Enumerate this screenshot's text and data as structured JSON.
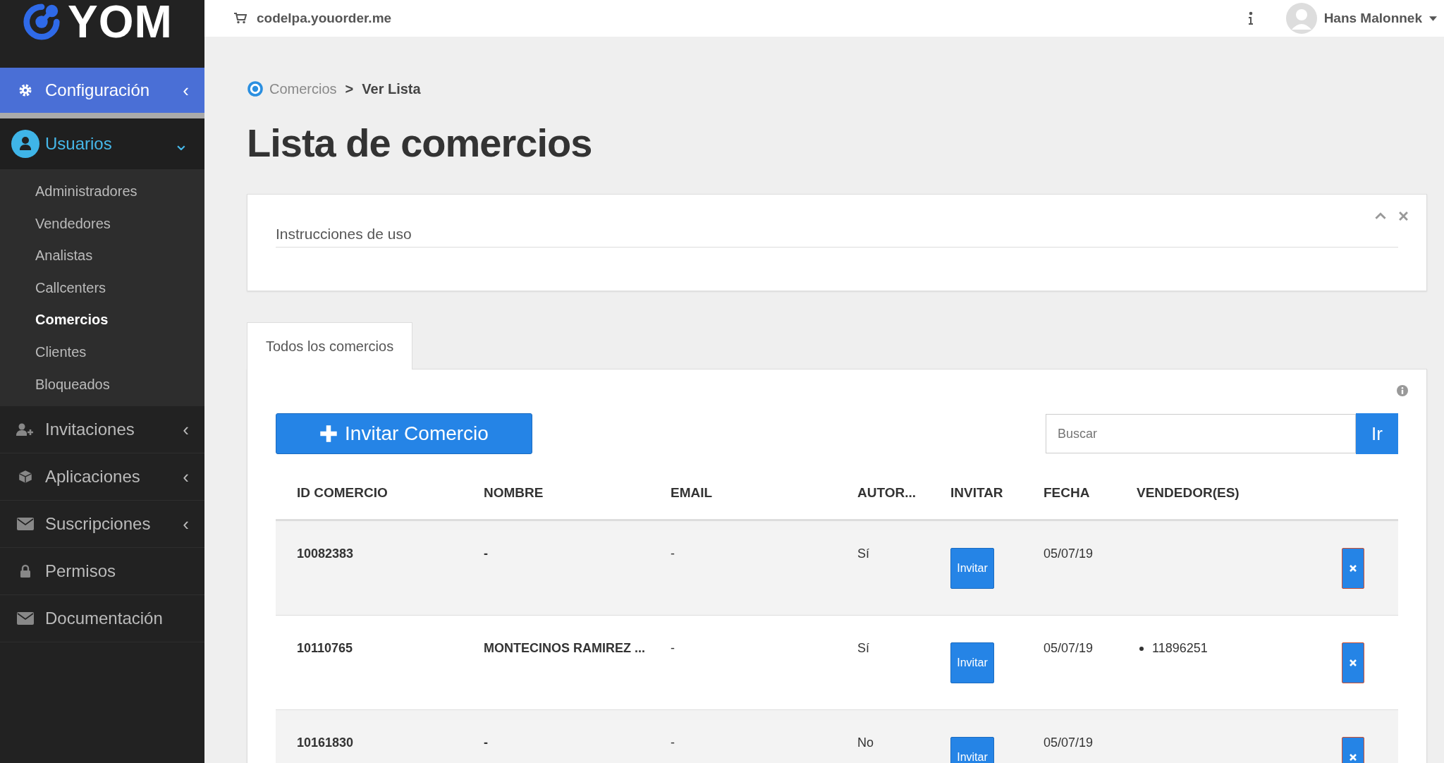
{
  "sidebar": {
    "logo": "YOM",
    "items": [
      {
        "label": "Configuración",
        "kind": "gear",
        "selected": true,
        "arrow": "‹",
        "expanded": false
      },
      {
        "label": "Usuarios",
        "kind": "user",
        "selected": false,
        "arrow": "⌄",
        "expanded": true,
        "children": [
          {
            "label": "Administradores",
            "selected": false
          },
          {
            "label": "Vendedores",
            "selected": false
          },
          {
            "label": "Analistas",
            "selected": false
          },
          {
            "label": "Callcenters",
            "selected": false
          },
          {
            "label": "Comercios",
            "selected": true
          },
          {
            "label": "Clientes",
            "selected": false
          },
          {
            "label": "Bloqueados",
            "selected": false
          }
        ]
      },
      {
        "label": "Invitaciones",
        "kind": "user-plus",
        "selected": false,
        "arrow": "‹",
        "expanded": false
      },
      {
        "label": "Aplicaciones",
        "kind": "cube",
        "selected": false,
        "arrow": "‹",
        "expanded": false
      },
      {
        "label": "Suscripciones",
        "kind": "envelope",
        "selected": false,
        "arrow": "‹",
        "expanded": false
      },
      {
        "label": "Permisos",
        "kind": "lock",
        "selected": false,
        "expanded": false
      },
      {
        "label": "Documentación",
        "kind": "envelope",
        "selected": false,
        "expanded": false
      }
    ]
  },
  "topbar": {
    "site": "codelpa.youorder.me",
    "user": "Hans Malonnek"
  },
  "breadcrumb": {
    "parent": "Comercios",
    "separator": ">",
    "current": "Ver Lista"
  },
  "title": "Lista de comercios",
  "instructions": {
    "title": "Instrucciones de uso"
  },
  "tabs": [
    {
      "label": "Todos los comercios",
      "selected": true
    }
  ],
  "invite_button": "Invitar Comercio",
  "search": {
    "placeholder": "Buscar",
    "button": "Ir"
  },
  "table": {
    "columns": [
      "ID COMERCIO",
      "NOMBRE",
      "EMAIL",
      "AUTOR...",
      "INVITAR",
      "FECHA",
      "VENDEDOR(ES)"
    ],
    "rows": [
      {
        "id": "10082383",
        "name": "-",
        "email": "-",
        "auth": "Sí",
        "invite": "Invitar",
        "date": "05/07/19",
        "sellers": []
      },
      {
        "id": "10110765",
        "name": "MONTECINOS RAMIREZ ...",
        "email": "-",
        "auth": "Sí",
        "invite": "Invitar",
        "date": "05/07/19",
        "sellers": [
          "11896251"
        ]
      },
      {
        "id": "10161830",
        "name": "-",
        "email": "-",
        "auth": "No",
        "invite": "Invitar",
        "date": "05/07/19",
        "sellers": []
      }
    ]
  }
}
